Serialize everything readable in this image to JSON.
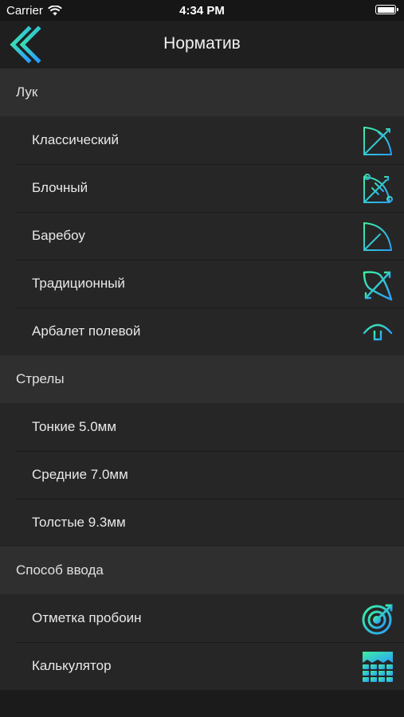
{
  "status_bar": {
    "carrier": "Carrier",
    "time": "4:34 PM"
  },
  "nav": {
    "title": "Норматив",
    "back_icon": "chevron-left-icon"
  },
  "colors": {
    "accent_green": "#39e6a8",
    "accent_blue": "#2aa6ff"
  },
  "sections": [
    {
      "header": "Лук",
      "items": [
        {
          "label": "Классический",
          "icon": "bow-classic-icon"
        },
        {
          "label": "Блочный",
          "icon": "bow-compound-icon"
        },
        {
          "label": "Баребоу",
          "icon": "bow-barebow-icon"
        },
        {
          "label": "Традиционный",
          "icon": "bow-traditional-icon"
        },
        {
          "label": "Арбалет полевой",
          "icon": "crossbow-icon"
        }
      ]
    },
    {
      "header": "Стрелы",
      "items": [
        {
          "label": "Тонкие 5.0мм"
        },
        {
          "label": "Средние 7.0мм"
        },
        {
          "label": "Толстые 9.3мм"
        }
      ]
    },
    {
      "header": "Способ ввода",
      "items": [
        {
          "label": "Отметка пробоин",
          "icon": "target-icon"
        },
        {
          "label": "Калькулятор",
          "icon": "calculator-icon"
        }
      ]
    }
  ]
}
